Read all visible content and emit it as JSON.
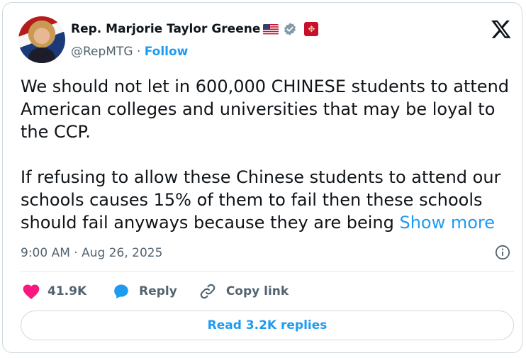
{
  "author": {
    "name": "Rep. Marjorie Taylor Greene",
    "handle": "@RepMTG",
    "separator": "·",
    "follow_label": "Follow",
    "badges": [
      "us-flag-icon",
      "verified-badge-icon",
      "affiliation-badge-icon"
    ]
  },
  "post": {
    "paragraph_1": "We should not let in 600,000 CHINESE students to attend American colleges and universities that may be loyal to the CCP.",
    "paragraph_2": "If refusing to allow these Chinese students to attend our schools causes 15% of them to fail then these schools should fail anyways because they are being",
    "show_more": "Show more",
    "timestamp": "9:00 AM · Aug 26, 2025"
  },
  "actions": {
    "likes": "41.9K",
    "reply_label": "Reply",
    "copy_label": "Copy link"
  },
  "read_replies_label": "Read 3.2K replies",
  "colors": {
    "accent": "#1d9bf0",
    "like": "#f91880",
    "text": "#0f1419",
    "secondary": "#536471",
    "border": "#cfd9de"
  }
}
